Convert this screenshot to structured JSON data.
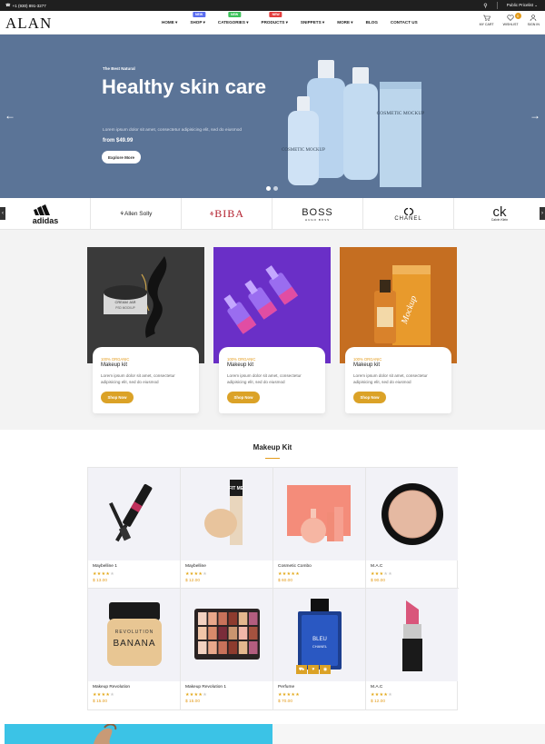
{
  "topbar": {
    "phone": "+1 (930) 891-3277",
    "currency": "Public Pricelist"
  },
  "header": {
    "logo": "ALAN",
    "nav": [
      {
        "label": "HOME",
        "caret": true,
        "badge": "",
        "badge_color": ""
      },
      {
        "label": "SHOP",
        "caret": true,
        "badge": "NEW",
        "badge_color": "#5a6df0"
      },
      {
        "label": "CATEGORIES",
        "caret": true,
        "badge": "NEW",
        "badge_color": "#3cc25a"
      },
      {
        "label": "PRODUCTS",
        "caret": true,
        "badge": "NEW",
        "badge_color": "#e33d3d"
      },
      {
        "label": "SNIPPETS",
        "caret": true,
        "badge": "",
        "badge_color": ""
      },
      {
        "label": "MORE",
        "caret": true,
        "badge": "",
        "badge_color": ""
      },
      {
        "label": "BLOG",
        "caret": false,
        "badge": "",
        "badge_color": ""
      },
      {
        "label": "CONTACT US",
        "caret": false,
        "badge": "",
        "badge_color": ""
      }
    ],
    "icons": {
      "cart": "MY CART",
      "wishlist": "WISHLIST",
      "wishlist_count": "0",
      "signin": "SIGN IN"
    }
  },
  "hero": {
    "eyebrow": "The Best Natural",
    "title": "Healthy skin care",
    "description": "Lorem ipsum dolor sit amet, consectetur adipisicing elit, sed do eiusmod",
    "price": "from $49.99",
    "button": "Explore More",
    "bottle_text": "COSMETIC MOCKUP",
    "box_text": "COSMETIC MOCKUP"
  },
  "brands": [
    "adidas",
    "Allen Solly",
    "BIBA",
    "BOSS",
    "CHANEL",
    "ck"
  ],
  "brand_sub": {
    "boss": "HUGO BOSS",
    "ck": "Calvin Klein"
  },
  "promos": [
    {
      "tag": "100% ORGANIC",
      "title": "Makeup kit",
      "desc": "Lorem ipsum dolor sit amet, consectetur adipisicing elit, sed do eiusmod",
      "button": "Shop Now",
      "bg": "#3a3a3a"
    },
    {
      "tag": "100% ORGANIC",
      "title": "Makeup kit",
      "desc": "Lorem ipsum dolor sit amet, consectetur adipisicing elit, sed do eiusmod",
      "button": "Shop Now",
      "bg": "#6a2fc7"
    },
    {
      "tag": "100% ORGANIC",
      "title": "Makeup kit",
      "desc": "Lorem ipsum dolor sit amet, consectetur adipisicing elit, sed do eiusmod",
      "button": "Shop Now",
      "bg": "#c56e21"
    }
  ],
  "section_title": "Makeup Kit",
  "products": [
    {
      "name": "Maybelline 1",
      "rating": 4,
      "price": "$ 13.00",
      "icon": "mascara-icon"
    },
    {
      "name": "Maybelline",
      "rating": 4,
      "price": "$ 12.00",
      "icon": "foundation-icon"
    },
    {
      "name": "Cosmetic Combo",
      "rating": 5,
      "price": "$ 60.00",
      "icon": "perfume-combo-icon"
    },
    {
      "name": "M.A.C",
      "rating": 3,
      "price": "$ 90.00",
      "icon": "compact-powder-icon"
    },
    {
      "name": "Makeup Revolution",
      "rating": 4,
      "price": "$ 15.00",
      "icon": "powder-jar-icon"
    },
    {
      "name": "Makeup Revolution 1",
      "rating": 4,
      "price": "$ 15.00",
      "icon": "eyeshadow-palette-icon"
    },
    {
      "name": "Perfume",
      "rating": 5,
      "price": "$ 70.00",
      "icon": "perfume-bottle-icon"
    },
    {
      "name": "M.A.C",
      "rating": 4,
      "price": "$ 12.00",
      "icon": "lipstick-icon"
    }
  ],
  "product_text": {
    "foundation": "FIT ME",
    "powder": "REVOLUTION",
    "powder_name": "BANANA",
    "perfume": "BLEU",
    "perfume_brand": "CHANEL",
    "cream": "CREAM JAR",
    "cream_sub": "PSD MOCKUP",
    "bottle": "Mockup"
  },
  "colors": {
    "accent": "#e39b1b",
    "hero_bg": "#5b7497",
    "button_gold": "#dba227"
  }
}
